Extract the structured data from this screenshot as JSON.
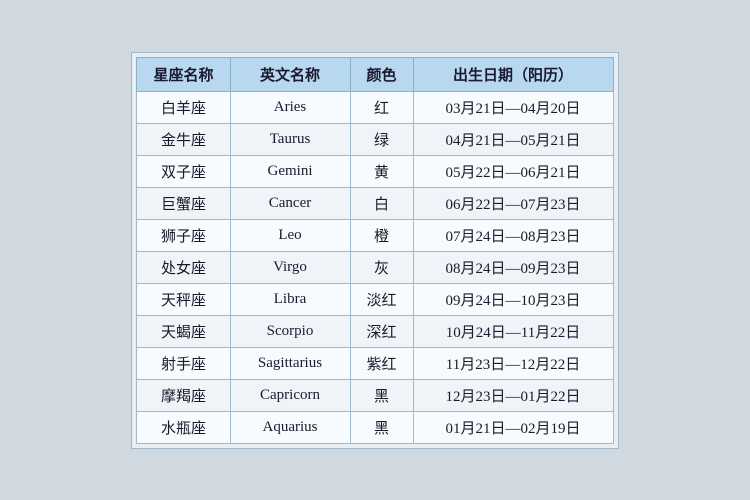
{
  "table": {
    "headers": {
      "col1": "星座名称",
      "col2": "英文名称",
      "col3": "颜色",
      "col4": "出生日期（阳历）"
    },
    "rows": [
      {
        "cn": "白羊座",
        "en": "Aries",
        "color": "红",
        "date": "03月21日—04月20日"
      },
      {
        "cn": "金牛座",
        "en": "Taurus",
        "color": "绿",
        "date": "04月21日—05月21日"
      },
      {
        "cn": "双子座",
        "en": "Gemini",
        "color": "黄",
        "date": "05月22日—06月21日"
      },
      {
        "cn": "巨蟹座",
        "en": "Cancer",
        "color": "白",
        "date": "06月22日—07月23日"
      },
      {
        "cn": "狮子座",
        "en": "Leo",
        "color": "橙",
        "date": "07月24日—08月23日"
      },
      {
        "cn": "处女座",
        "en": "Virgo",
        "color": "灰",
        "date": "08月24日—09月23日"
      },
      {
        "cn": "天秤座",
        "en": "Libra",
        "color": "淡红",
        "date": "09月24日—10月23日"
      },
      {
        "cn": "天蝎座",
        "en": "Scorpio",
        "color": "深红",
        "date": "10月24日—11月22日"
      },
      {
        "cn": "射手座",
        "en": "Sagittarius",
        "color": "紫红",
        "date": "11月23日—12月22日"
      },
      {
        "cn": "摩羯座",
        "en": "Capricorn",
        "color": "黑",
        "date": "12月23日—01月22日"
      },
      {
        "cn": "水瓶座",
        "en": "Aquarius",
        "color": "黑",
        "date": "01月21日—02月19日"
      }
    ]
  }
}
